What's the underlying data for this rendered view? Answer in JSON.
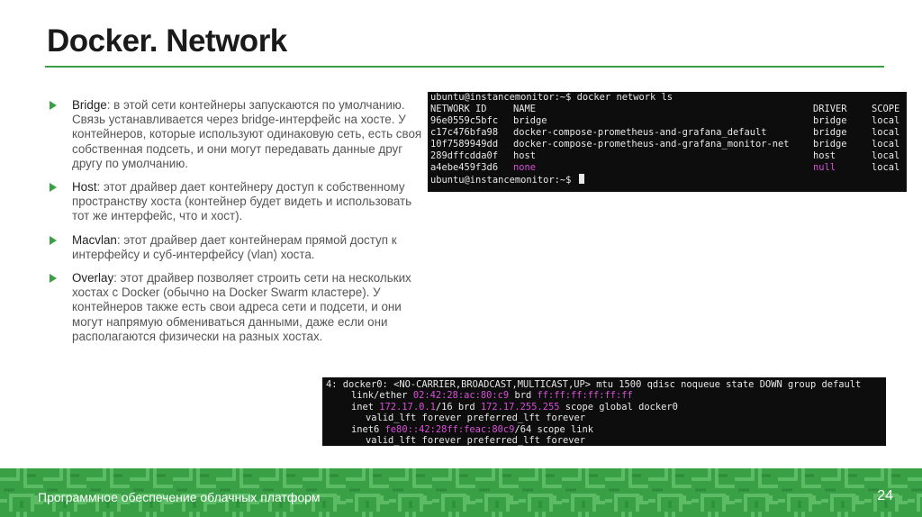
{
  "slide": {
    "title": "Docker. Network",
    "bullets": [
      {
        "term": "Bridge",
        "text": ": в этой сети контейнеры запускаются по умолчанию. Связь устанавливается через bridge-интерфейс на хосте. У контейнеров, которые используют одинаковую сеть, есть своя собственная подсеть, и они могут передавать данные друг другу по умолчанию."
      },
      {
        "term": "Host",
        "text": ": этот драйвер дает контейнеру доступ к собственному пространству хоста (контейнер будет видеть и использовать тот же интерфейс, что и хост)."
      },
      {
        "term": "Macvlan",
        "text": ": этот драйвер дает контейнерам прямой доступ к интерфейсу и суб-интерфейсу (vlan) хоста."
      },
      {
        "term": "Overlay",
        "text": ": этот драйвер позволяет строить сети на нескольких хостах с Docker (обычно на Docker Swarm кластере). У контейнеров также есть свои адреса сети и подсети, и они могут напрямую обмениваться данными, даже если они располагаются физически на разных хостах."
      }
    ]
  },
  "terminal1": {
    "command": "ubuntu@instancemonitor:~$ docker network ls",
    "headers": {
      "id": "NETWORK ID",
      "name": "NAME",
      "driver": "DRIVER",
      "scope": "SCOPE"
    },
    "rows": [
      {
        "id": "96e0559c5bfc",
        "name": "bridge",
        "driver": "bridge",
        "scope": "local"
      },
      {
        "id": "c17c476bfa98",
        "name": "docker-compose-prometheus-and-grafana_default",
        "driver": "bridge",
        "scope": "local"
      },
      {
        "id": "10f7589949dd",
        "name": "docker-compose-prometheus-and-grafana_monitor-net",
        "driver": "bridge",
        "scope": "local"
      },
      {
        "id": "289dffcdda0f",
        "name": "host",
        "driver": "host",
        "scope": "local"
      },
      {
        "id": "a4ebe459f3d6",
        "name": "none",
        "driver": "null",
        "scope": "local"
      }
    ],
    "prompt": "ubuntu@instancemonitor:~$"
  },
  "terminal2": {
    "line1": "4: docker0: <NO-CARRIER,BROADCAST,MULTICAST,UP> mtu 1500 qdisc noqueue state DOWN group default",
    "line2_a": "link/ether ",
    "line2_mac": "02:42:28:ac:80:c9",
    "line2_b": " brd ",
    "line2_brd": "ff:ff:ff:ff:ff:ff",
    "line3_a": "inet ",
    "line3_ip": "172.17.0.1",
    "line3_b": "/16 brd ",
    "line3_brd": "172.17.255.255",
    "line3_c": " scope global docker0",
    "line4": "valid_lft forever preferred_lft forever",
    "line5_a": "inet6 ",
    "line5_ip": "fe80::42:28ff:feac:80c9",
    "line5_b": "/64 scope link",
    "line6": "valid_lft forever preferred_lft forever"
  },
  "footer": {
    "text": "Программное обеспечение облачных платформ",
    "page": "24"
  },
  "colors": {
    "accent": "#3aa046",
    "terminal_bg": "#0d0d0d",
    "magenta": "#d84fd8"
  }
}
